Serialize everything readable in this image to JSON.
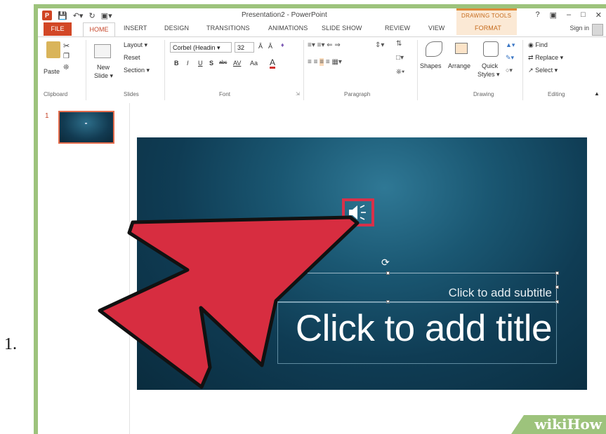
{
  "step_number": "1.",
  "window": {
    "title": "Presentation2 - PowerPoint",
    "contextual_tab_group": "DRAWING TOOLS",
    "controls": [
      "?",
      "▣",
      "–",
      "□",
      "✕"
    ],
    "sign_in": "Sign in"
  },
  "tabs": {
    "file": "FILE",
    "home": "HOME",
    "insert": "INSERT",
    "design": "DESIGN",
    "transitions": "TRANSITIONS",
    "animations": "ANIMATIONS",
    "slide_show": "SLIDE SHOW",
    "review": "REVIEW",
    "view": "VIEW",
    "format": "FORMAT"
  },
  "ribbon": {
    "clipboard": {
      "paste": "Paste",
      "label": "Clipboard"
    },
    "slides": {
      "new_slide": "New",
      "new_slide2": "Slide ▾",
      "layout": "Layout ▾",
      "reset": "Reset",
      "section": "Section ▾",
      "label": "Slides"
    },
    "font": {
      "font_name": "Corbel (Headin ▾",
      "font_size": "32",
      "label": "Font",
      "bold": "B",
      "italic": "I",
      "underline": "U",
      "strike": "S",
      "abc": "abc",
      "spacing": "AV",
      "case": "Aa",
      "color": "A"
    },
    "paragraph": {
      "label": "Paragraph"
    },
    "drawing": {
      "shapes": "Shapes",
      "arrange": "Arrange",
      "quick": "Quick",
      "styles": "Styles ▾",
      "label": "Drawing"
    },
    "editing": {
      "find": "Find",
      "replace": "Replace ▾",
      "select": "Select ▾",
      "label": "Editing"
    }
  },
  "thumbnails": {
    "slide_number": "1"
  },
  "slide": {
    "subtitle_placeholder": "Click to add subtitle",
    "title_placeholder": "Click to add title"
  },
  "watermark": {
    "brand": "wikiHow"
  },
  "colors": {
    "accent_red": "#d8314a",
    "file_tab": "#d24726",
    "slide_dark": "#0f3c54"
  }
}
